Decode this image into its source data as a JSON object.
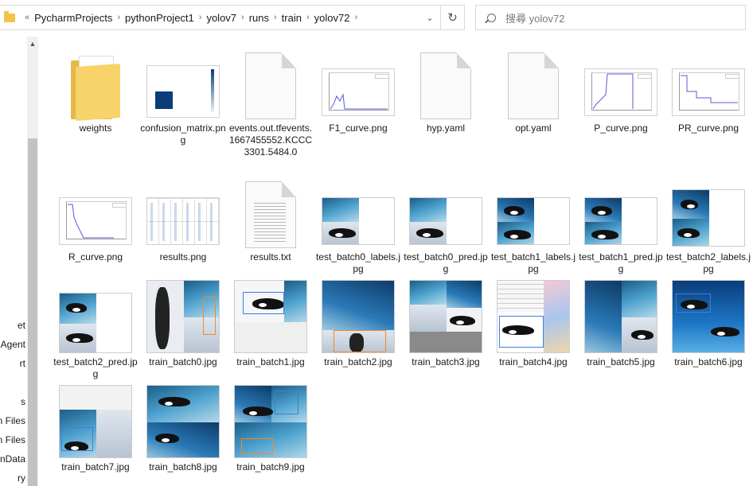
{
  "address_bar": {
    "overflow": "«",
    "path": [
      "PycharmProjects",
      "pythonProject1",
      "yolov7",
      "runs",
      "train",
      "yolov72"
    ]
  },
  "search": {
    "placeholder": "搜尋 yolov72"
  },
  "nav_pane": {
    "items": [
      "et",
      "Agent",
      "rt",
      "s",
      "n Files",
      "n Files",
      "nData",
      "ry"
    ]
  },
  "files": [
    {
      "name": "weights",
      "kind": "folder"
    },
    {
      "name": "confusion_matrix.png",
      "kind": "confusion"
    },
    {
      "name": "events.out.tfevents.1667455552.KCCC3301.5484.0",
      "kind": "doc"
    },
    {
      "name": "F1_curve.png",
      "kind": "curve"
    },
    {
      "name": "hyp.yaml",
      "kind": "doc"
    },
    {
      "name": "opt.yaml",
      "kind": "doc"
    },
    {
      "name": "P_curve.png",
      "kind": "curve"
    },
    {
      "name": "PR_curve.png",
      "kind": "curve"
    },
    {
      "name": "R_curve.png",
      "kind": "curve"
    },
    {
      "name": "results.png",
      "kind": "results"
    },
    {
      "name": "results.txt",
      "kind": "text"
    },
    {
      "name": "test_batch0_labels.jpg",
      "kind": "batch"
    },
    {
      "name": "test_batch0_pred.jpg",
      "kind": "batch"
    },
    {
      "name": "test_batch1_labels.jpg",
      "kind": "batch"
    },
    {
      "name": "test_batch1_pred.jpg",
      "kind": "batch"
    },
    {
      "name": "test_batch2_labels.jpg",
      "kind": "batch"
    },
    {
      "name": "test_batch2_pred.jpg",
      "kind": "batch"
    },
    {
      "name": "train_batch0.jpg",
      "kind": "batch"
    },
    {
      "name": "train_batch1.jpg",
      "kind": "batch"
    },
    {
      "name": "train_batch2.jpg",
      "kind": "batch"
    },
    {
      "name": "train_batch3.jpg",
      "kind": "batch"
    },
    {
      "name": "train_batch4.jpg",
      "kind": "batch"
    },
    {
      "name": "train_batch5.jpg",
      "kind": "batch"
    },
    {
      "name": "train_batch6.jpg",
      "kind": "batch"
    },
    {
      "name": "train_batch7.jpg",
      "kind": "batch"
    },
    {
      "name": "train_batch8.jpg",
      "kind": "batch"
    },
    {
      "name": "train_batch9.jpg",
      "kind": "batch"
    }
  ],
  "icons": {
    "folder": "folder-icon",
    "refresh": "refresh-icon",
    "search": "search-icon",
    "dropdown": "chevron-down-icon",
    "scroll_up": "chevron-up-icon"
  },
  "colors": {
    "folder": "#f3c34a",
    "accent_blue": "#3f7fd8",
    "label_orange": "#ef8a2a"
  }
}
